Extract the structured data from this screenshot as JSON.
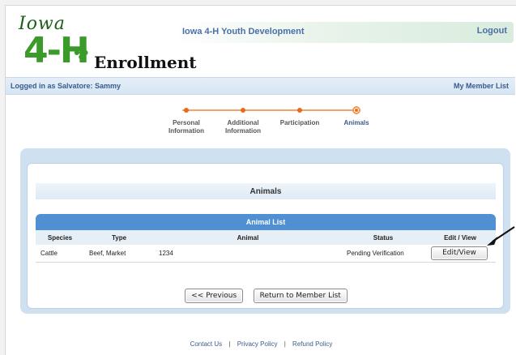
{
  "header": {
    "logo": {
      "iowa": "Iowa",
      "fourh": "4-H",
      "enrollment": "Enrollment"
    },
    "title": "Iowa 4-H Youth Development",
    "logout": "Logout"
  },
  "userbar": {
    "logged_in": "Logged in as Salvatore: Sammy",
    "member_list_link": "My Member List"
  },
  "steps": [
    {
      "line1": "Personal",
      "line2": "Information"
    },
    {
      "line1": "Additional",
      "line2": "Information"
    },
    {
      "line1": "Participation",
      "line2": ""
    },
    {
      "line1": "Animals",
      "line2": ""
    }
  ],
  "section_title": "Animals",
  "table": {
    "caption": "Animal List",
    "columns": [
      "Species",
      "Type",
      "Animal",
      "Status",
      "Edit / View"
    ],
    "rows": [
      {
        "species": "Cattle",
        "type": "Beef, Market",
        "animal": "1234",
        "status": "Pending Verification",
        "action": "Edit/View"
      }
    ]
  },
  "buttons": {
    "previous": "<< Previous",
    "return": "Return to Member List"
  },
  "footer": {
    "contact": "Contact Us",
    "privacy": "Privacy Policy",
    "refund": "Refund Policy",
    "separator": "|"
  },
  "colors": {
    "accent_blue": "#4f8fd2",
    "step_orange": "#ea6a1a",
    "brand_green": "#3a9a2a",
    "link_blue": "#4a6fa8"
  }
}
